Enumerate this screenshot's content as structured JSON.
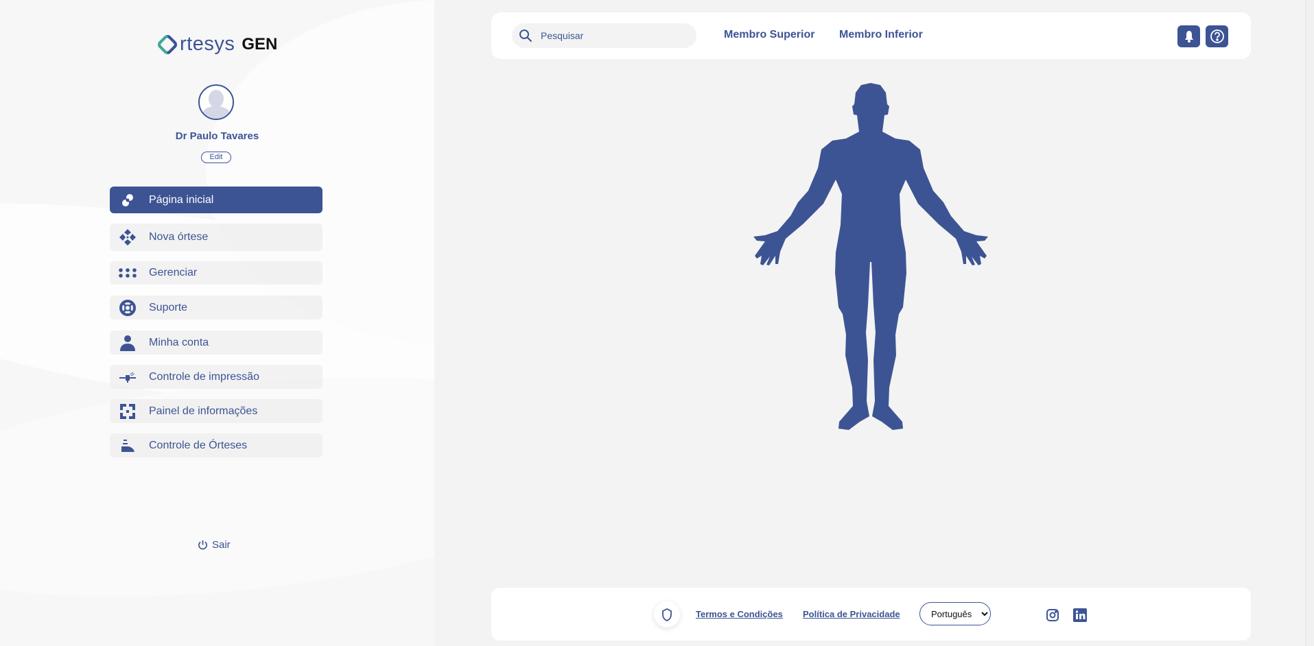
{
  "brand": {
    "logo_text": "rtesys",
    "logo_suffix": "GEN"
  },
  "user": {
    "name": "Dr Paulo Tavares",
    "edit_label": "Edit"
  },
  "sidebar": {
    "items": [
      {
        "label": "Página inicial",
        "icon": "bandage-icon",
        "active": true
      },
      {
        "label": "Nova órtese",
        "icon": "diamond-arrows-icon"
      },
      {
        "label": "Gerenciar",
        "icon": "dots-grid-icon"
      },
      {
        "label": "Suporte",
        "icon": "lifebuoy-icon"
      },
      {
        "label": "Minha conta",
        "icon": "user-icon"
      },
      {
        "label": "Controle de impressão",
        "icon": "printer-nozzle-icon"
      },
      {
        "label": "Painel de informações",
        "icon": "dashboard-icon"
      },
      {
        "label": "Controle de Órteses",
        "icon": "foot-orthosis-icon"
      }
    ],
    "logout_label": "Sair"
  },
  "header": {
    "search_placeholder": "Pesquisar",
    "nav": [
      "Membro Superior",
      "Membro Inferior"
    ],
    "icons": [
      "bell-icon",
      "help-icon"
    ]
  },
  "footer": {
    "terms": "Termos e Condições",
    "privacy": "Política de Privacidade",
    "language": "Português",
    "social": [
      "instagram-icon",
      "linkedin-icon"
    ]
  },
  "colors": {
    "primary": "#3d5494",
    "accent": "#3fa99a",
    "background": "#f3f3f3"
  }
}
